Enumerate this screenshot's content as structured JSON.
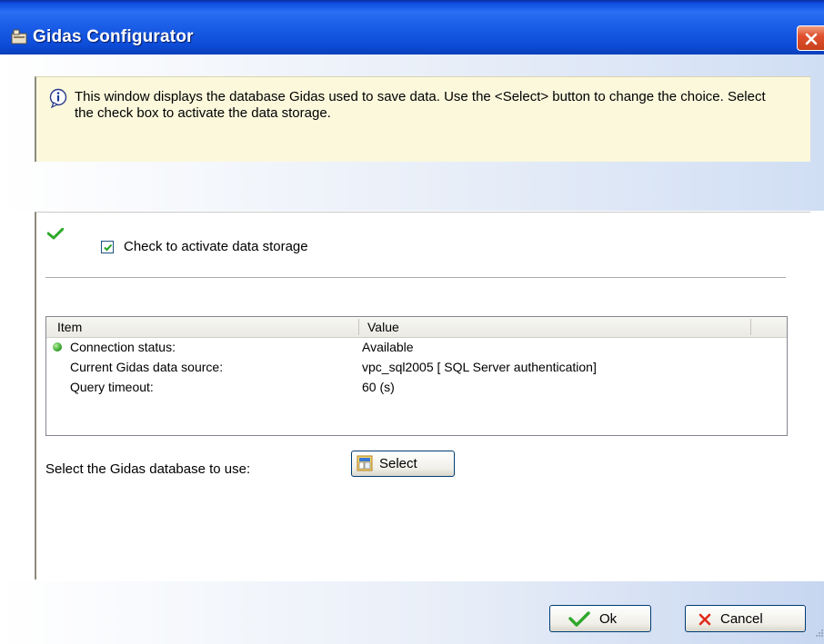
{
  "window": {
    "title": "Gidas Configurator"
  },
  "info": {
    "text": "This window displays the database Gidas used to save data. Use the <Select> button to change the choice. Select the check box to activate the data storage."
  },
  "storage": {
    "checkbox_label": "Check to activate data storage",
    "checked": true
  },
  "list": {
    "headers": [
      "Item",
      "Value"
    ],
    "rows": [
      {
        "item": "Connection status:",
        "value": "Available",
        "status_icon": "green-status-dot"
      },
      {
        "item": "Current Gidas data source:",
        "value": "vpc_sql2005 [ SQL Server authentication]"
      },
      {
        "item": "Query timeout:",
        "value": "60 (s)"
      }
    ]
  },
  "select_section": {
    "label": "Select the Gidas database to use:",
    "button_label": "Select"
  },
  "footer": {
    "ok_label": "Ok",
    "cancel_label": "Cancel"
  },
  "colors": {
    "titlebar": "#1c5fe8",
    "info_background": "#fbf8dc",
    "accent_green": "#3aa830",
    "close_red": "#e05030"
  }
}
